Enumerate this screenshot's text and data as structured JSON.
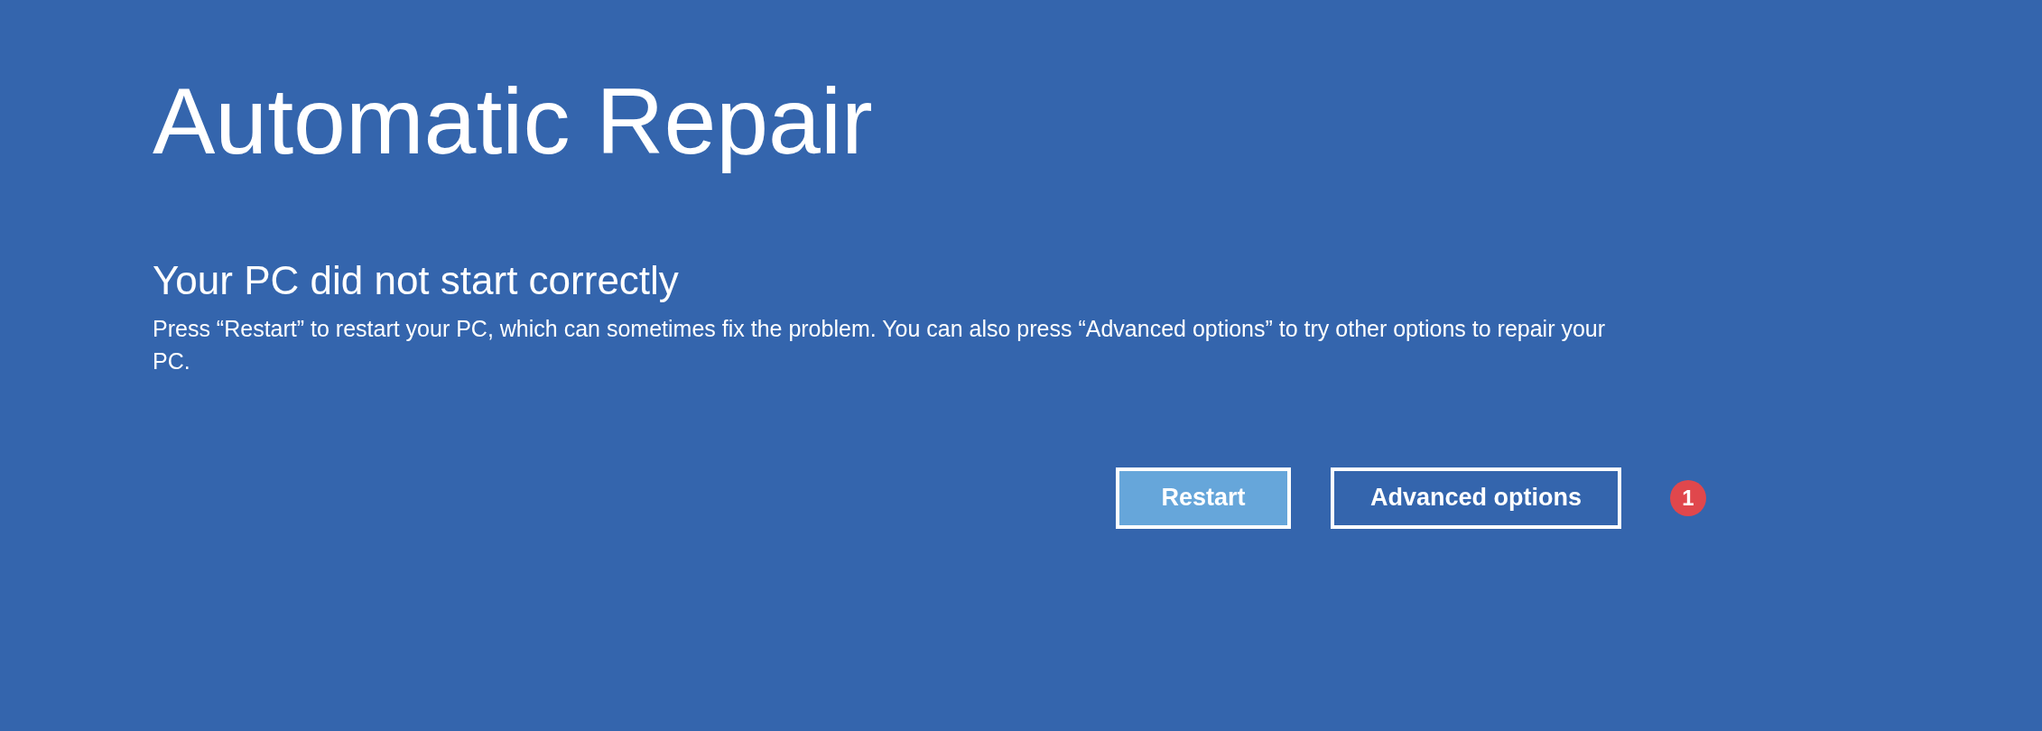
{
  "title": "Automatic Repair",
  "heading": "Your PC did not start correctly",
  "message": "Press “Restart” to restart your PC, which can sometimes fix the problem. You can also press “Advanced options” to try other options to repair your PC.",
  "buttons": [
    {
      "label": "Restart",
      "selected": true
    },
    {
      "label": "Advanced options",
      "selected": false
    }
  ],
  "badge": "1"
}
